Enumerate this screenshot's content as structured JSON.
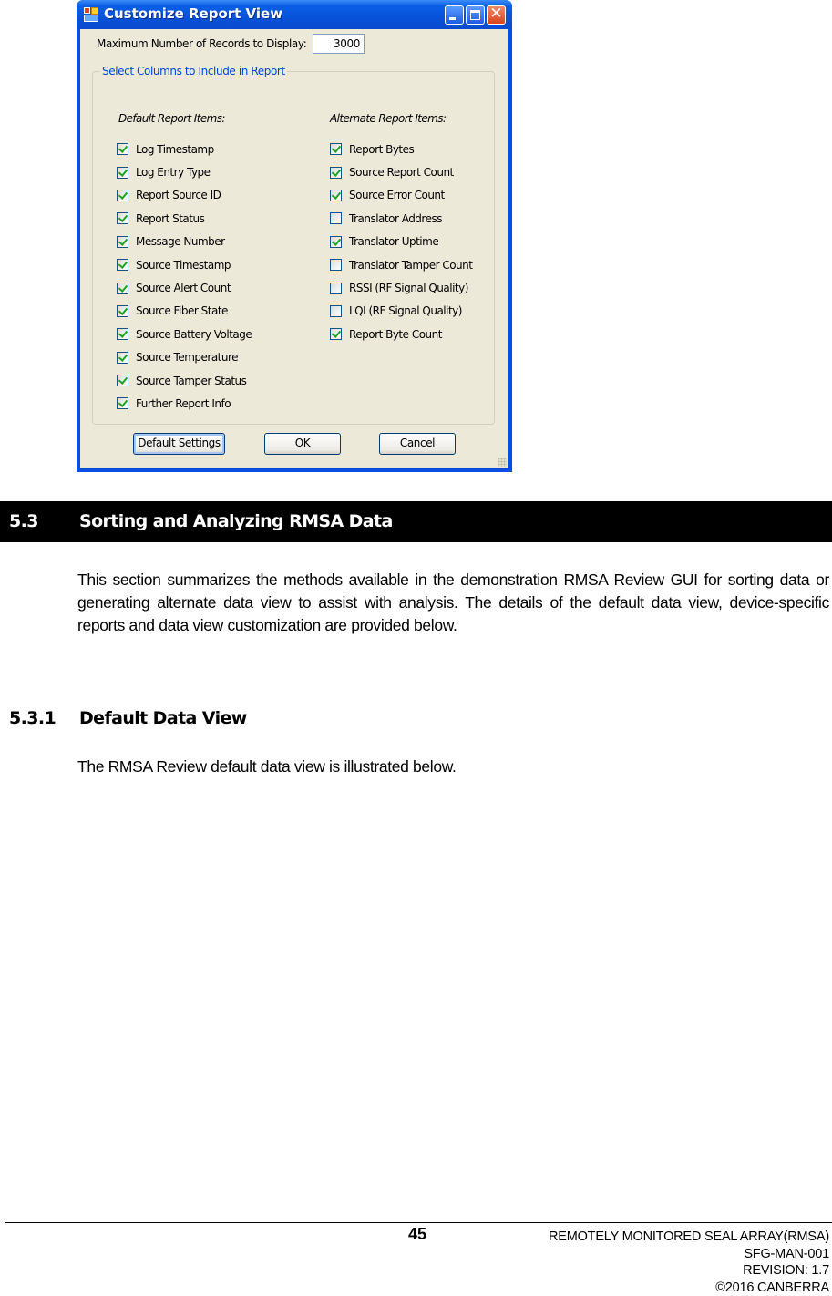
{
  "dialog": {
    "title": "Customize Report View",
    "icons": {
      "app": "app-window-icon",
      "minimize": "minimize-icon",
      "maximize": "maximize-icon",
      "close": "close-icon"
    },
    "close_glyph": "✕",
    "max_records_label": "Maximum Number of Records to Display:",
    "max_records_value": "3000",
    "group_title": "Select Columns to Include in Report",
    "default_heading": "Default Report Items:",
    "alternate_heading": "Alternate Report Items:",
    "default_items": [
      {
        "label": "Log Timestamp",
        "checked": true
      },
      {
        "label": "Log Entry Type",
        "checked": true
      },
      {
        "label": "Report Source ID",
        "checked": true
      },
      {
        "label": "Report Status",
        "checked": true
      },
      {
        "label": "Message Number",
        "checked": true
      },
      {
        "label": "Source Timestamp",
        "checked": true
      },
      {
        "label": "Source Alert Count",
        "checked": true
      },
      {
        "label": "Source Fiber State",
        "checked": true
      },
      {
        "label": "Source Battery Voltage",
        "checked": true
      },
      {
        "label": "Source Temperature",
        "checked": true
      },
      {
        "label": "Source Tamper Status",
        "checked": true
      },
      {
        "label": "Further Report Info",
        "checked": true
      }
    ],
    "alternate_items": [
      {
        "label": "Report Bytes",
        "checked": true
      },
      {
        "label": "Source Report Count",
        "checked": true
      },
      {
        "label": "Source Error Count",
        "checked": true
      },
      {
        "label": "Translator Address",
        "checked": false
      },
      {
        "label": "Translator Uptime",
        "checked": true
      },
      {
        "label": "Translator Tamper Count",
        "checked": false
      },
      {
        "label": "RSSI (RF Signal Quality)",
        "checked": false
      },
      {
        "label": "LQI (RF Signal Quality)",
        "checked": false
      },
      {
        "label": "Report Byte Count",
        "checked": true
      }
    ],
    "buttons": {
      "default_settings": "Default Settings",
      "ok": "OK",
      "cancel": "Cancel"
    }
  },
  "section": {
    "number": "5.3",
    "title": "Sorting and Analyzing RMSA Data",
    "body": "This section summarizes the methods available in the demonstration RMSA Review GUI for sorting data or generating alternate data view to assist with analysis.  The details of the default data view, device-specific reports and data view customization are provided below."
  },
  "subsection": {
    "number": "5.3.1",
    "title": "Default Data View",
    "body": "The RMSA Review default data view is illustrated below."
  },
  "footer": {
    "page_number": "45",
    "lines": [
      "REMOTELY MONITORED SEAL ARRAY(RMSA)",
      "SFG-MAN-001",
      "REVISION: 1.7",
      "©2016 CANBERRA"
    ]
  }
}
